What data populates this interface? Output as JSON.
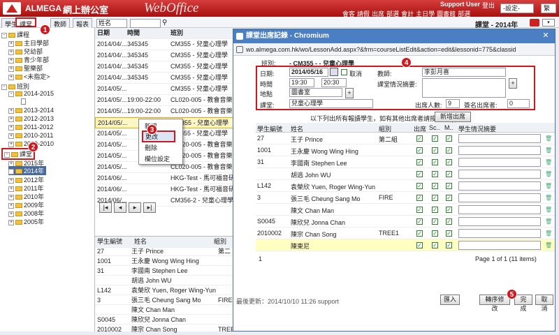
{
  "header": {
    "brand": "ALMEGA",
    "brand_cn": "網上辦公室",
    "product": "WebOffice",
    "user": "Support User",
    "logout": "登出",
    "links": [
      "會客",
      "請假",
      "出席",
      "部選",
      "會計",
      "主日學",
      "圖書館",
      "部選"
    ],
    "setting_select": "-設定-",
    "style_select": "繁"
  },
  "nav": {
    "tabs": [
      "學生",
      "課堂",
      "教師",
      "報表"
    ],
    "term": "課堂 - 2014年",
    "filter_value": "姓名"
  },
  "tree": [
    {
      "label": "課程",
      "lvl": 0
    },
    {
      "label": "主日學部",
      "lvl": 1
    },
    {
      "label": "兒幼部",
      "lvl": 1
    },
    {
      "label": "青少年部",
      "lvl": 1
    },
    {
      "label": "聖樂部",
      "lvl": 1
    },
    {
      "label": "<未指定>",
      "lvl": 1
    },
    {
      "label": "班別",
      "lvl": 0
    },
    {
      "label": "2014-2015",
      "lvl": 1
    },
    {
      "label": "",
      "lvl": 2
    },
    {
      "label": "2013-2014",
      "lvl": 1
    },
    {
      "label": "2012-2013",
      "lvl": 1
    },
    {
      "label": "2011-2012",
      "lvl": 1
    },
    {
      "label": "2010-2011",
      "lvl": 1
    },
    {
      "label": "2009-2010",
      "lvl": 1
    },
    {
      "label": "課堂",
      "lvl": 0
    },
    {
      "label": "2015年",
      "lvl": 1
    },
    {
      "label": "2014年",
      "lvl": 1
    },
    {
      "label": "2012年",
      "lvl": 1
    },
    {
      "label": "2011年",
      "lvl": 1
    },
    {
      "label": "2010年",
      "lvl": 1
    },
    {
      "label": "2009年",
      "lvl": 1
    },
    {
      "label": "2008年",
      "lvl": 1
    },
    {
      "label": "2005年",
      "lvl": 1
    }
  ],
  "grid": {
    "headers": [
      "日期",
      "時間",
      "班別"
    ],
    "rows": [
      [
        "2014/04/...",
        "345345",
        "CM355 - 兒童心理學"
      ],
      [
        "2014/04/...",
        "345345",
        "CM355 - 兒童心理學"
      ],
      [
        "2014/04/...",
        "345345",
        "CM355 - 兒童心理學"
      ],
      [
        "2014/04/...",
        "345345",
        "CM355 - 兒童心理學"
      ],
      [
        "2014/05/...",
        "",
        "CM355 - 兒童心理學"
      ],
      [
        "2014/05/...",
        "19:00-22:00",
        "CL020-005 - 教會音樂崇"
      ],
      [
        "2014/05/...",
        "19:00-22:00",
        "CL020-005 - 教會音樂崇"
      ],
      [
        "2014/05/...",
        "",
        "CM355 - 兒童心理學"
      ],
      [
        "2014/05/...",
        "",
        "CM355 - 兒童心理學"
      ],
      [
        "2014/05/...",
        "",
        "CL020-005 - 教會音樂崇"
      ],
      [
        "2014/05/...",
        "",
        "CL020-005 - 教會音樂崇"
      ],
      [
        "2014/05/...",
        "",
        "CL020-005 - 教會音樂崇"
      ],
      [
        "2014/06/...",
        "",
        "HKG-Test - 馬可福音研"
      ],
      [
        "2014/06/...",
        "",
        "HKG-Test - 馬可福音研"
      ],
      [
        "2014/06/...",
        "",
        "CM356-2 - 兒童心理學"
      ]
    ],
    "highlight_label": "2014/05/..."
  },
  "context_menu": [
    "新增",
    "更改",
    "刪除",
    "欄位設定"
  ],
  "lower": {
    "headers": [
      "學生編號",
      "姓名",
      "組別"
    ],
    "rows": [
      [
        "27",
        "王子 Prince",
        "第二"
      ],
      [
        "1001",
        "王永慶 Wong Wing Hing",
        ""
      ],
      [
        "31",
        "李國南 Stephen Lee",
        ""
      ],
      [
        "",
        "胡逃 John WU",
        ""
      ],
      [
        "L142",
        "袁榮欣 Yuen, Roger Wing-Yun",
        ""
      ],
      [
        "3",
        "張三毛 Cheung Sang Mo",
        "FIRE"
      ],
      [
        "",
        "陳文 Chan Man",
        ""
      ],
      [
        "S0045",
        "陳欣兒 Jonna Chan",
        ""
      ],
      [
        "2010002",
        "陳宗 Chan Song",
        "TREE1"
      ]
    ]
  },
  "dialog": {
    "title": "課堂出席記錄 - Chromium",
    "url": "wo.almega.com.hk/wo/LessonAdd.aspx?&frm=courseListEdit&action=edit&lessonid=775&classid",
    "class_label": "班別:",
    "class_value": "- CM355 - - 兒童心理學",
    "date_label": "日期:",
    "date_value": "2014/05/16",
    "cancel_label": "取消",
    "time_label": "時間",
    "time_from": "19:30",
    "time_to": "20:30",
    "place_label": "地點",
    "place_value": "圖書室",
    "lesson_label": "課堂:",
    "lesson_value": "兒童心理學",
    "teacher_label": "教師:",
    "teacher_value": "李彭月喜",
    "summary_label": "課堂情況摘要:",
    "attend_label": "出席人數:",
    "attend_value": "9",
    "signed_label": "簽名出席者:",
    "signed_value": "0",
    "note": "以下列出所有報讀學生，如有其他出席者請按",
    "new_attendee_btn": "新增出席者",
    "headers": [
      "學生編號",
      "姓名",
      "組別",
      "出席",
      "Sc..",
      "M..",
      "學生情況摘要"
    ],
    "rows": [
      {
        "id": "27",
        "name": "王子 Prince",
        "group": "第二組",
        "c1": "✓",
        "c2": "✓",
        "c3": "✓"
      },
      {
        "id": "1001",
        "name": "王永慶 Wong Wing Hing",
        "group": "",
        "c1": "✓",
        "c2": "✓",
        "c3": "✓"
      },
      {
        "id": "31",
        "name": "李國南 Stephen Lee",
        "group": "",
        "c1": "✓",
        "c2": "✓",
        "c3": "✓"
      },
      {
        "id": "",
        "name": "胡逃 John WU",
        "group": "",
        "c1": "✓",
        "c2": "✓",
        "c3": "✓"
      },
      {
        "id": "L142",
        "name": "袁榮欣 Yuen, Roger Wing-Yun",
        "group": "",
        "c1": "✓",
        "c2": "✓",
        "c3": "✓"
      },
      {
        "id": "3",
        "name": "張三毛 Cheung Sang Mo",
        "group": "FIRE",
        "c1": "✓",
        "c2": "✓",
        "c3": "✓"
      },
      {
        "id": "",
        "name": "陳文 Chan Man",
        "group": "",
        "c1": "✓",
        "c2": "✓",
        "c3": "✓"
      },
      {
        "id": "S0045",
        "name": "陳欣兒 Jonna Chan",
        "group": "",
        "c1": "✓",
        "c2": "✓",
        "c3": "✓"
      },
      {
        "id": "2010002",
        "name": "陳宗 Chan Song",
        "group": "TREE1",
        "c1": "✓",
        "c2": "✓",
        "c3": "✓"
      },
      {
        "id": "",
        "name": "陳東尼",
        "group": "",
        "c1": "✓",
        "c2": "✓",
        "c3": "✓"
      }
    ],
    "footer_left": "1",
    "pager": "Page 1 of 1 (11 items)",
    "last_update": "最後更新：2014/10/10 11:26 support",
    "import_btn": "匯入",
    "reorder_btn": "轉序修改",
    "done_btn": "完成",
    "cancel_btn": "取消"
  },
  "badges": [
    "1",
    "2",
    "3",
    "4",
    "5"
  ]
}
